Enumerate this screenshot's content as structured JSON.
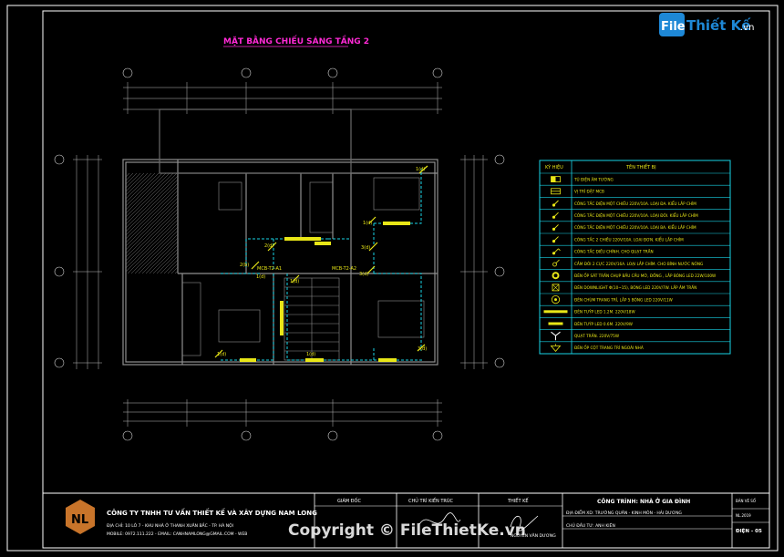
{
  "title": "MẶT BẰNG CHIẾU SÁNG TẦNG 2",
  "watermark_logo": {
    "left": "File",
    "right": "Thiết Kế",
    "suffix": ".vn"
  },
  "colors": {
    "bg": "#000000",
    "border": "#ffffff",
    "cyan": "#19d3e6",
    "yellow": "#e8e617",
    "magenta": "#ff2ad6",
    "wall": "#8f8f8f",
    "grid": "#cfcfcf",
    "brand": "#c8742a"
  },
  "legend": {
    "headers": [
      "KÝ HIỆU",
      "TÊN THIẾT BỊ"
    ],
    "rows": [
      {
        "icon": "panel-icon",
        "label": "TỦ ĐIỆN ÂM TƯỜNG"
      },
      {
        "icon": "mcb-icon",
        "label": "VỊ TRÍ ĐẶT MCB"
      },
      {
        "icon": "switch-icon",
        "label": "CÔNG TẮC ĐIỆN MỘT CHIỀU 220V/10A. LOẠI ĐA. KIỂU LẮP CHÌM"
      },
      {
        "icon": "switch-icon",
        "label": "CÔNG TẮC ĐIỆN MỘT CHIỀU 220V/10A. LOẠI ĐÔI. KIỂU LẮP CHÌM"
      },
      {
        "icon": "switch-icon",
        "label": "CÔNG TẮC ĐIỆN MỘT CHIỀU 220V/10A. LOẠI BA. KIỂU LẮP CHÌM"
      },
      {
        "icon": "switch-icon",
        "label": "CÔNG TẮC 2 CHIỀU 220V/10A. LOẠI ĐƠN. KIỂU LẮP CHÌM"
      },
      {
        "icon": "fan-switch-icon",
        "label": "CÔNG TẮC ĐIỀU CHỈNH. CHO QUẠT TRẦN"
      },
      {
        "icon": "socket-icon",
        "label": "CẮM ĐÔI 2 CỰC 220V/16A. LOẠI LẮP CHÌM. CHO BÌNH NƯỚC NÓNG"
      },
      {
        "icon": "ceiling-light-icon",
        "label": "ĐÈN ỐP SÁT TRẦN CHỤP BẦU CẦU MỜ, ĐỒNG , LẮP BÓNG LED 22W/100W"
      },
      {
        "icon": "downlight-icon",
        "label": "ĐÈN DOWNLIGHT Φ(10~15), BÓNG LED 220V/7W. LẮP ÂM TRẦN"
      },
      {
        "icon": "chandelier-icon",
        "label": "ĐÈN CHÙM TRANG TRÍ, LẮP 5 BÓNG LED 220V/11W"
      },
      {
        "icon": "tube-led-icon",
        "label": "ĐÈN TUÝP LED 1.2M. 220V/18W"
      },
      {
        "icon": "tube-led-short-icon",
        "label": "ĐÈN TUÝP LED 0.6M. 220V/9W"
      },
      {
        "icon": "ceiling-fan-icon",
        "label": "QUẠT TRẦN. 220V/75W"
      },
      {
        "icon": "wall-lamp-icon",
        "label": "ĐÈN ỐP CỘT TRANG TRÍ NGOÀI NHÀ"
      }
    ]
  },
  "plan_labels": {
    "a1": "1(d)",
    "a2": "1(d)",
    "a3": "3(d)",
    "a4": "2(d)",
    "a5": "2(b)",
    "a6": "1(d)",
    "a7": "3(d)",
    "a8": "MCB-T2-A1",
    "a9": "MCB-T2-A2",
    "a10": "3(d)",
    "a11": "1(d)",
    "a12": "1(d)",
    "a13": "1(d)"
  },
  "title_block": {
    "company": "CÔNG TY TNHH TƯ VẤN THIẾT KẾ VÀ XÂY DỰNG NAM LONG",
    "company_addr": "ĐỊA CHỈ: 10 LÔ 7 - KHU NHÀ Ở THANH XUÂN BẮC - TP. HÀ NỘI",
    "company_contact": "MOBILE: 0972.111.222 - EMAIL: CANHNAMLONG@GMAIL.COM - WEB",
    "col1_header": "GIÁM ĐỐC",
    "col2_header": "CHỦ TRÌ KIẾN TRÚC",
    "col3_header": "THIẾT KẾ",
    "designer_name": "NGUYỄN VĂN DƯƠNG",
    "project_header": "CÔNG TRÌNH: NHÀ Ở GIA ĐÌNH",
    "project_location": "ĐỊA ĐIỂM XD: TRƯỜNG QUÂN - KINH MÔN - HẢI DƯƠNG",
    "owner": "CHỦ ĐẦU TƯ: ANH KIÊN",
    "sheet_code_label": "BẢN VẼ SỐ",
    "sheet_scale": "NL.2019",
    "sheet_number": "ĐIỆN - 05"
  },
  "copyright": "Copyright © FileThietKe.vn"
}
